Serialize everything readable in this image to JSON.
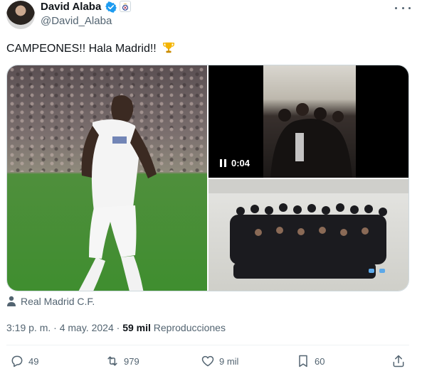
{
  "author": {
    "name": "David Alaba",
    "handle": "@David_Alaba"
  },
  "tweet": {
    "text": "CAMPEONES!! Hala Madrid!!"
  },
  "media": {
    "video_time": "0:04"
  },
  "location": {
    "label": "Real Madrid C.F."
  },
  "meta": {
    "time": "3:19 p. m.",
    "separator1": "·",
    "date": "4 may. 2024",
    "separator2": "·",
    "views_count": "59 mil",
    "views_label": "Reproducciones"
  },
  "actions": {
    "replies": "49",
    "reposts": "979",
    "likes": "9 mil",
    "bookmarks": "60"
  },
  "colors": {
    "verified": "#1d9bf0",
    "secondary_text": "#536471"
  }
}
